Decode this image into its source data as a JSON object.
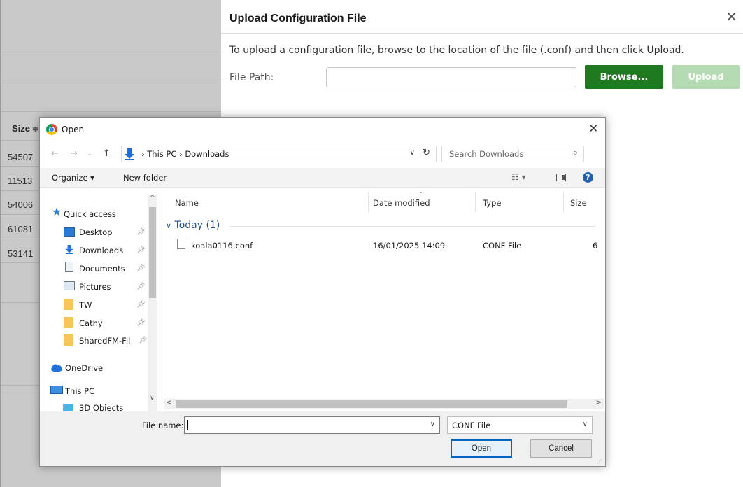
{
  "background": {
    "size_header": "Size",
    "size_rows": [
      "54507",
      "11513",
      "54006",
      "61081",
      "53141"
    ]
  },
  "modal": {
    "title": "Upload Configuration File",
    "description": "To upload a configuration file, browse to the location of the file (.conf) and then click Upload.",
    "file_path_label": "File Path:",
    "file_path_value": "",
    "browse_label": "Browse...",
    "upload_label": "Upload",
    "colors": {
      "browse": "#1f7a1f",
      "upload_disabled": "#b5dbb3"
    }
  },
  "dialog": {
    "title": "Open",
    "address": {
      "pc": "This PC",
      "folder": "Downloads"
    },
    "search_placeholder": "Search Downloads",
    "toolbar": {
      "organize": "Organize ▾",
      "new_folder": "New folder"
    },
    "nav": [
      {
        "label": "Quick access",
        "icon": "star-icon"
      },
      {
        "label": "Desktop",
        "icon": "desktop-icon",
        "pinned": true
      },
      {
        "label": "Downloads",
        "icon": "download-arrow-icon",
        "pinned": true
      },
      {
        "label": "Documents",
        "icon": "document-icon",
        "pinned": true
      },
      {
        "label": "Pictures",
        "icon": "pictures-icon",
        "pinned": true
      },
      {
        "label": "TW",
        "icon": "folder-icon",
        "pinned": true
      },
      {
        "label": "Cathy",
        "icon": "folder-icon",
        "pinned": true
      },
      {
        "label": "SharedFM-Fil",
        "icon": "folder-icon",
        "pinned": true
      },
      {
        "label": "OneDrive",
        "icon": "cloud-icon"
      },
      {
        "label": "This PC",
        "icon": "computer-icon"
      },
      {
        "label": "3D Objects",
        "icon": "cube-icon"
      }
    ],
    "columns": {
      "name": "Name",
      "date": "Date modified",
      "type": "Type",
      "size": "Size"
    },
    "group": "Today (1)",
    "files": [
      {
        "name": "koala0116.conf",
        "date": "16/01/2025 14:09",
        "type": "CONF File",
        "size": "6"
      }
    ],
    "file_name_label": "File name:",
    "file_name_value": "",
    "file_type": "CONF File",
    "open_label": "Open",
    "cancel_label": "Cancel"
  }
}
